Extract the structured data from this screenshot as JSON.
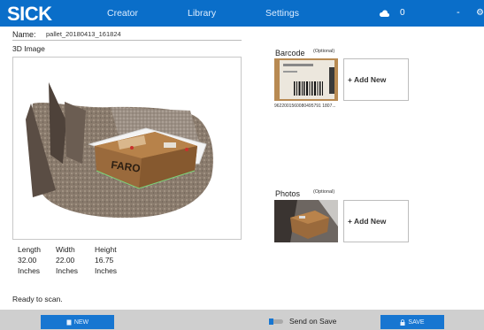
{
  "app": {
    "logo": "SICK",
    "nav": [
      "Creator",
      "Library",
      "Settings"
    ],
    "cloud_count": "0",
    "minimize_symbol": "-"
  },
  "scan": {
    "name_label": "Name:",
    "name_value": "pallet_20180413_161824",
    "image_title": "3D Image"
  },
  "dimensions": [
    {
      "label": "Length",
      "value": "32.00",
      "unit": "Inches"
    },
    {
      "label": "Width",
      "value": "22.00",
      "unit": "Inches"
    },
    {
      "label": "Height",
      "value": "16.75",
      "unit": "Inches"
    }
  ],
  "status": "Ready to scan.",
  "barcode": {
    "title": "Barcode",
    "optional": "(Optional)",
    "add_label": "+ Add New",
    "number": "9622001560080495791 1807..."
  },
  "photos": {
    "title": "Photos",
    "optional": "(Optional)",
    "add_label": "+ Add New"
  },
  "bottom": {
    "new_label": "NEW",
    "save_label": "SAVE",
    "send_on_save": "Send on Save"
  },
  "colors": {
    "brand": "#0a6ec9",
    "button": "#1776d1",
    "bottom_bar": "#cfcfcf"
  },
  "icons": [
    "cloud-icon",
    "minimize-icon",
    "gear-icon",
    "file-icon",
    "lock-icon",
    "toggle-switch"
  ]
}
